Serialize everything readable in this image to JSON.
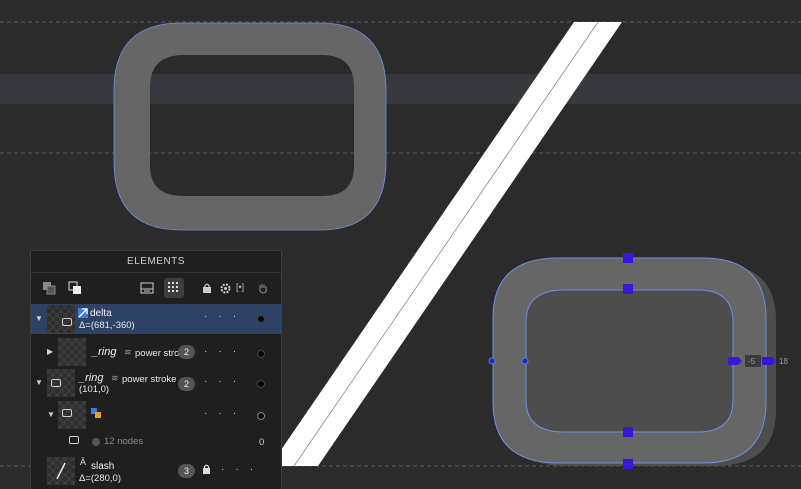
{
  "panel": {
    "title": "ELEMENTS"
  },
  "toolbar": {
    "icons": [
      "boolean-union-icon",
      "bring-front-icon",
      "list-view-icon",
      "grid-view-icon",
      "lock-icon",
      "gear-icon",
      "code-icon",
      "hand-icon"
    ],
    "code_label": "[•]"
  },
  "rows": [
    {
      "name": "delta",
      "offset": "Δ=(681,-360)",
      "selected": true
    },
    {
      "name": "_ring",
      "effect": "power stro",
      "count": "2"
    },
    {
      "name": "_ring",
      "effect": "power stroke",
      "offset": "(101,0)",
      "count": "2"
    },
    {
      "name": ""
    },
    {
      "nodes": "12 nodes",
      "value": "0"
    },
    {
      "name": "slash",
      "offset": "Δ=(280,0)",
      "count": "3"
    }
  ],
  "canvas": {
    "handle_labels": [
      "-5",
      "18"
    ]
  },
  "colors": {
    "background": "#2b2b2b",
    "panel": "#1f1f1f",
    "selection": "#2d4264",
    "shape_fill": "#666666",
    "outline": "#6f8fe0",
    "handle": "#3a17d6"
  }
}
